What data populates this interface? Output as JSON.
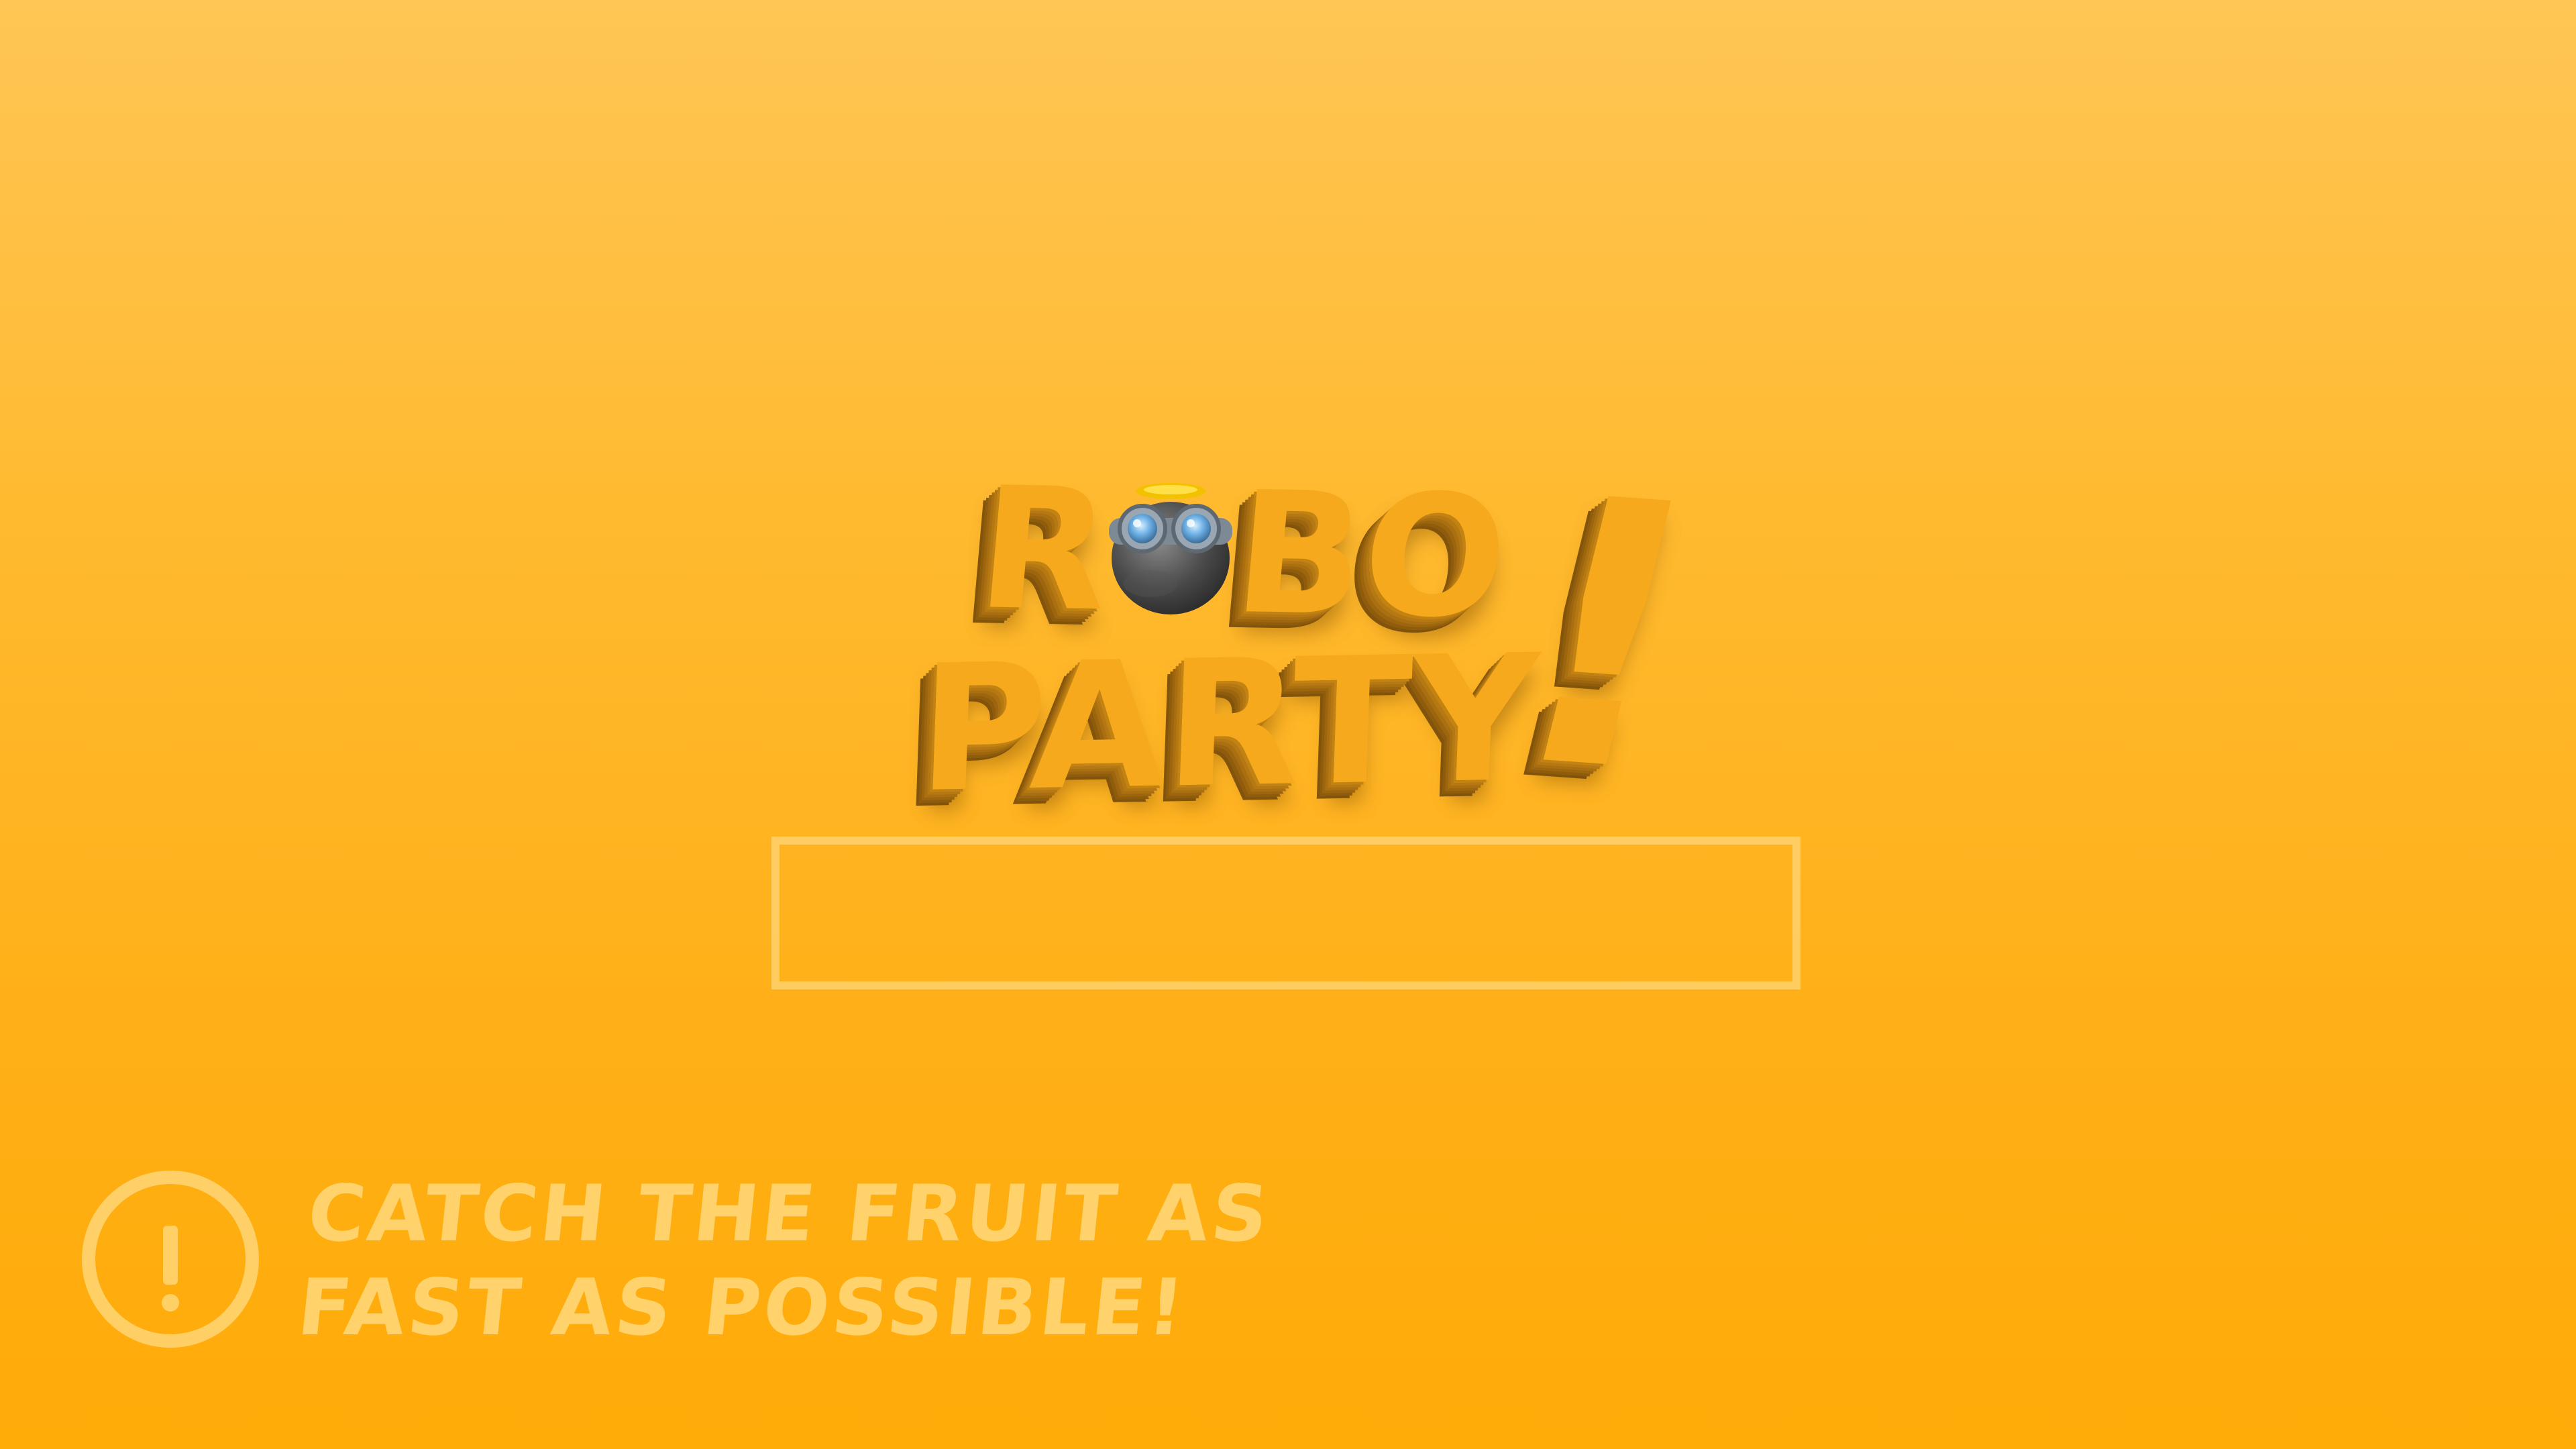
{
  "logo": {
    "word_top": "ROBO",
    "word_top_before": "R",
    "word_top_after": "BO",
    "word_bottom": "PARTY",
    "exclamation": "!"
  },
  "loading": {
    "progress": 0
  },
  "hint": {
    "icon": "exclamation-circle-icon",
    "line1": "Catch the fruit as",
    "line2": "fast as possible!"
  },
  "colors": {
    "background_top": "#ffc655",
    "background_bottom": "#ffab08",
    "logo": "#f6a91c",
    "accent_light": "#ffd87d"
  }
}
